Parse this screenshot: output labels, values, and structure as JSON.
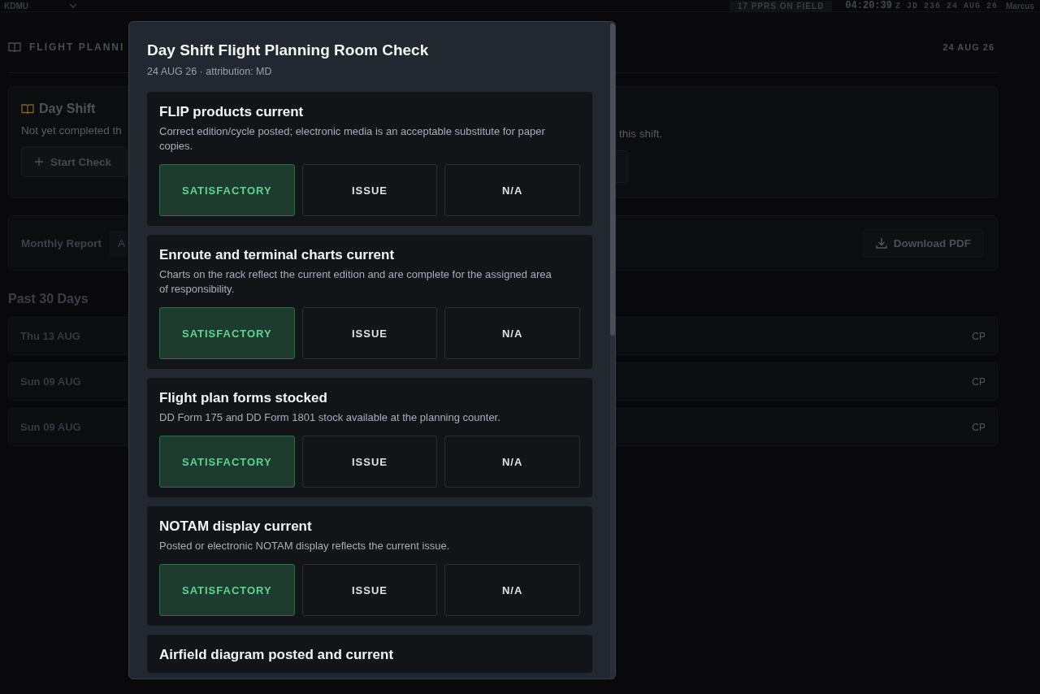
{
  "top_bar": {
    "station": "KDMU",
    "pprs": "17 PPRS ON FIELD",
    "clock": "04:20:39",
    "clock_suffix": "Z JD 236 24 AUG 26",
    "user": "Marcus"
  },
  "page": {
    "section_title": "FLIGHT PLANNI",
    "date": "24 AUG 26"
  },
  "shift_card": {
    "title": "Day Shift",
    "status_start": "Not yet completed th",
    "status_end": "this shift.",
    "start_button": "Start Check"
  },
  "report_bar": {
    "label": "Monthly Report",
    "field": "A",
    "download_button": "Download PDF"
  },
  "history": {
    "title": "Past 30 Days",
    "rows": [
      {
        "date": "Thu 13 AUG",
        "initials": "CP"
      },
      {
        "date": "Sun 09 AUG",
        "initials": "CP"
      },
      {
        "date": "Sun 09 AUG",
        "initials": "CP"
      }
    ]
  },
  "modal": {
    "title": "Day Shift Flight Planning Room Check",
    "subtitle": "24 AUG 26 · attribution: MD",
    "items": [
      {
        "title": "FLIP products current",
        "description": "Correct edition/cycle posted; electronic media is an acceptable substitute for paper copies.",
        "options": [
          {
            "label": "SATISFACTORY",
            "selected": true
          },
          {
            "label": "ISSUE",
            "selected": false
          },
          {
            "label": "N/A",
            "selected": false
          }
        ]
      },
      {
        "title": "Enroute and terminal charts current",
        "description": "Charts on the rack reflect the current edition and are complete for the assigned area of responsibility.",
        "options": [
          {
            "label": "SATISFACTORY",
            "selected": true
          },
          {
            "label": "ISSUE",
            "selected": false
          },
          {
            "label": "N/A",
            "selected": false
          }
        ]
      },
      {
        "title": "Flight plan forms stocked",
        "description": "DD Form 175 and DD Form 1801 stock available at the planning counter.",
        "options": [
          {
            "label": "SATISFACTORY",
            "selected": true
          },
          {
            "label": "ISSUE",
            "selected": false
          },
          {
            "label": "N/A",
            "selected": false
          }
        ]
      },
      {
        "title": "NOTAM display current",
        "description": "Posted or electronic NOTAM display reflects the current issue.",
        "options": [
          {
            "label": "SATISFACTORY",
            "selected": true
          },
          {
            "label": "ISSUE",
            "selected": false
          },
          {
            "label": "N/A",
            "selected": false
          }
        ]
      },
      {
        "title": "Airfield diagram posted and current"
      }
    ]
  }
}
